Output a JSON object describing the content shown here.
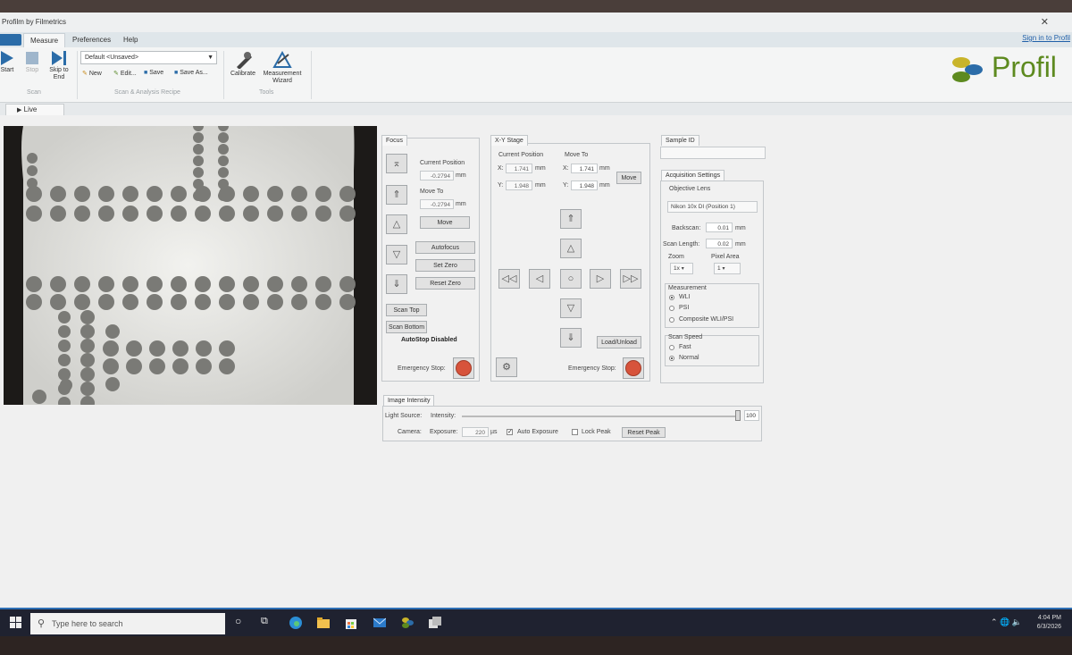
{
  "window": {
    "title": "Profilm by Filmetrics",
    "signin": "Sign in to Profil"
  },
  "menu": {
    "tabs": [
      "Measure",
      "Preferences",
      "Help"
    ],
    "active": "Measure"
  },
  "ribbon": {
    "scan": {
      "start": "Start",
      "stop": "Stop",
      "skip": "Skip to End",
      "group": "Scan"
    },
    "recipe": {
      "selected": "Default <Unsaved>",
      "new": "New",
      "edit": "Edit...",
      "save": "Save",
      "save_as": "Save As...",
      "group": "Scan & Analysis Recipe"
    },
    "tools": {
      "calibrate": "Calibrate",
      "wizard": "Measurement Wizard",
      "group": "Tools"
    },
    "logo": "Profil"
  },
  "live_tab": "Live",
  "focus": {
    "title": "Focus",
    "current_label": "Current Position",
    "current_value": "-0.2794",
    "current_unit": "mm",
    "moveto_label": "Move To",
    "moveto_value": "-0.2794",
    "moveto_unit": "mm",
    "move": "Move",
    "autofocus": "Autofocus",
    "set_zero": "Set Zero",
    "reset_zero": "Reset Zero",
    "scan_top": "Scan Top",
    "scan_bottom": "Scan Bottom",
    "autostop": "AutoStop Disabled",
    "emergency": "Emergency Stop:"
  },
  "xy": {
    "title": "X-Y Stage",
    "current_label": "Current Position",
    "moveto_label": "Move To",
    "x_label": "X:",
    "y_label": "Y:",
    "cur_x": "1.741",
    "cur_y": "1.948",
    "to_x": "1.741",
    "to_y": "1.948",
    "unit": "mm",
    "move": "Move",
    "load": "Load/Unload",
    "emergency": "Emergency Stop:"
  },
  "sample": {
    "title": "Sample ID",
    "value": ""
  },
  "acq": {
    "title": "Acquisition Settings",
    "lens_label": "Objective Lens",
    "lens_value": "Nikon 10x DI (Position 1)",
    "backscan_label": "Backscan:",
    "backscan_value": "0.01",
    "scanlen_label": "Scan Length:",
    "scanlen_value": "0.02",
    "unit": "mm",
    "zoom_label": "Zoom",
    "zoom_value": "1x",
    "pixel_label": "Pixel Area",
    "pixel_value": "1",
    "measurement_label": "Measurement",
    "m1": "WLI",
    "m2": "PSI",
    "m3": "Composite WLI/PSI",
    "speed_label": "Scan Speed",
    "s1": "Fast",
    "s2": "Normal"
  },
  "intensity": {
    "title": "Image Intensity",
    "light_source": "Light Source:",
    "intensity_label": "Intensity:",
    "intensity_value": "100",
    "intensity_level": 1.0,
    "camera": "Camera:",
    "exposure_label": "Exposure:",
    "exposure_value": "220",
    "exposure_unit": "µs",
    "auto_exposure": "Auto Exposure",
    "lock_peak": "Lock Peak",
    "reset_peak": "Reset Peak"
  },
  "taskbar": {
    "search_placeholder": "Type here to search",
    "time": "4:04 PM",
    "date": "6/3/2026"
  },
  "colors": {
    "accent": "#2b6ca8",
    "estop": "#d7533b",
    "logo": "#5d8a1f"
  }
}
